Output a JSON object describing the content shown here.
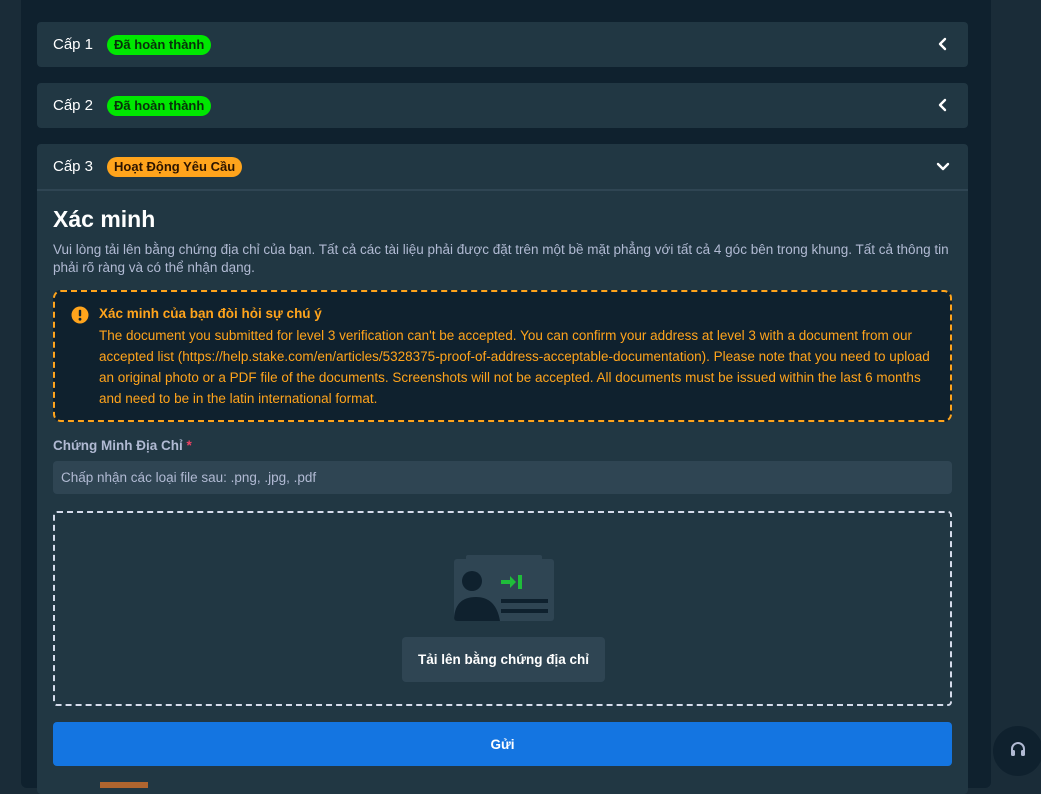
{
  "levels": [
    {
      "label": "Cấp 1",
      "status": "Đã hoàn thành"
    },
    {
      "label": "Cấp 2",
      "status": "Đã hoàn thành"
    },
    {
      "label": "Cấp 3",
      "status": "Hoạt Động Yêu Cầu"
    }
  ],
  "verification": {
    "title": "Xác minh",
    "description": "Vui lòng tải lên bằng chứng địa chỉ của bạn. Tất cả các tài liệu phải được đặt trên một bề mặt phẳng với tất cả 4 góc bên trong khung. Tất cả thông tin phải rõ ràng và có thể nhận dạng.",
    "alert_title": "Xác minh của bạn đòi hỏi sự chú ý",
    "alert_body": "The document you submitted for level 3 verification can't be accepted. You can confirm your address at level 3 with a document from our accepted list (https://help.stake.com/en/articles/5328375-proof-of-address-acceptable-documentation). Please note that you need to upload an original photo or a PDF file of the documents. Screenshots will not be accepted. All documents must be issued within the last 6 months and need to be in the latin international format.",
    "field_label": "Chứng Minh Địa Chỉ",
    "required_mark": "*",
    "file_hint": "Chấp nhận các loại file sau: .png, .jpg, .pdf",
    "upload_button": "Tải lên bằng chứng địa chỉ",
    "submit_button": "Gửi"
  },
  "icons": {
    "collapse": "chevron-left-icon",
    "expand": "chevron-down-icon",
    "alert": "exclamation-circle-icon",
    "id_card": "id-card-icon",
    "support": "headset-icon"
  },
  "colors": {
    "completed": "#00e701",
    "pending": "#ffa41c",
    "primary": "#1475e1"
  }
}
